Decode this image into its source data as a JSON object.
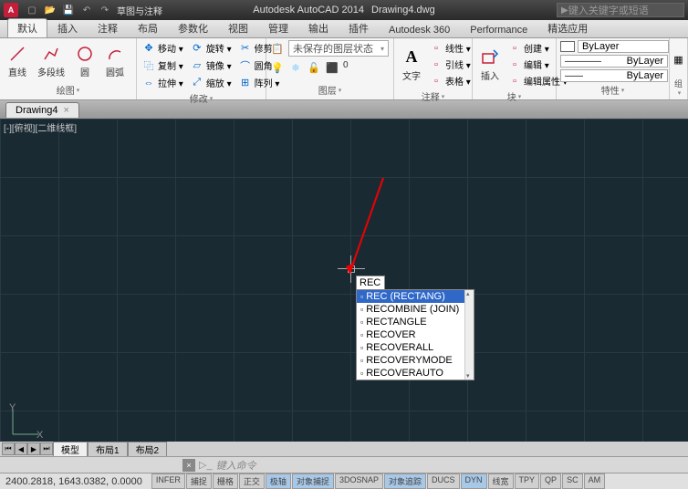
{
  "title": {
    "app": "Autodesk AutoCAD 2014",
    "doc": "Drawing4.dwg",
    "search_ph": "键入关键字或短语",
    "menubar": "草图与注释"
  },
  "qat": [
    "new",
    "open",
    "save",
    "undo",
    "redo"
  ],
  "tabs": [
    "默认",
    "插入",
    "注释",
    "布局",
    "参数化",
    "视图",
    "管理",
    "输出",
    "插件",
    "Autodesk 360",
    "Performance",
    "精选应用"
  ],
  "panels": {
    "draw": {
      "title": "绘图",
      "items": [
        "直线",
        "多段线",
        "圆",
        "圆弧"
      ]
    },
    "modify": {
      "title": "修改",
      "rows": [
        [
          "移动",
          "旋转",
          "修剪"
        ],
        [
          "复制",
          "镜像",
          "圆角"
        ],
        [
          "拉伸",
          "缩放",
          "阵列"
        ]
      ]
    },
    "layer": {
      "title": "图层",
      "state": "未保存的图层状态",
      "icons": [
        "on",
        "freeze",
        "lock",
        "color",
        "more"
      ]
    },
    "annot": {
      "title": "注释",
      "text": "文字",
      "rows": [
        "线性",
        "引线",
        "表格"
      ]
    },
    "block": {
      "title": "块",
      "insert": "插入",
      "rows": [
        "创建",
        "编辑",
        "编辑属性"
      ]
    },
    "props": {
      "title": "特性",
      "bylayer": "ByLayer"
    },
    "group": {
      "title": "组"
    }
  },
  "doctab": "Drawing4",
  "viewport": "[-][俯视][二维线框]",
  "cmd_typed": "REC",
  "autocomplete": [
    {
      "label": "REC (RECTANG)",
      "sel": true
    },
    {
      "label": "RECOMBINE (JOIN)"
    },
    {
      "label": "RECTANGLE"
    },
    {
      "label": "RECOVER"
    },
    {
      "label": "RECOVERALL"
    },
    {
      "label": "RECOVERYMODE"
    },
    {
      "label": "RECOVERAUTO"
    }
  ],
  "model_tabs": [
    "模型",
    "布局1",
    "布局2"
  ],
  "cmd_prompt": "键入命令",
  "coords": "2400.2818, 1643.0382, 0.0000",
  "status_btns": [
    "INFER",
    "捕捉",
    "栅格",
    "正交",
    "极轴",
    "对象捕捉",
    "3DOSNAP",
    "对象追踪",
    "DUCS",
    "DYN",
    "线宽",
    "TPY",
    "QP",
    "SC",
    "AM"
  ]
}
